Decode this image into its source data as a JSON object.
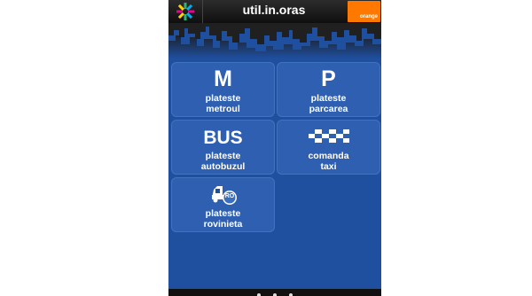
{
  "header": {
    "title": "util.in.oras",
    "operator_logo_text": "orange",
    "operator_color": "#ff7900",
    "app_logo_icon": "star-burst-logo-icon"
  },
  "tiles": [
    {
      "icon_text": "M",
      "line1": "plateste",
      "line2": "metroul"
    },
    {
      "icon_text": "P",
      "line1": "plateste",
      "line2": "parcarea"
    },
    {
      "icon_text": "BUS",
      "line1": "plateste",
      "line2": "autobuzul"
    },
    {
      "icon": "taxi-checker-icon",
      "line1": "comanda",
      "line2": "taxi"
    },
    {
      "icon": "rovinieta-car-icon",
      "icon_badge": "RO",
      "line1": "plateste",
      "line2": "rovinieta"
    }
  ],
  "theme": {
    "background": "#1f4f9f",
    "tile": "#3c6ebe"
  }
}
